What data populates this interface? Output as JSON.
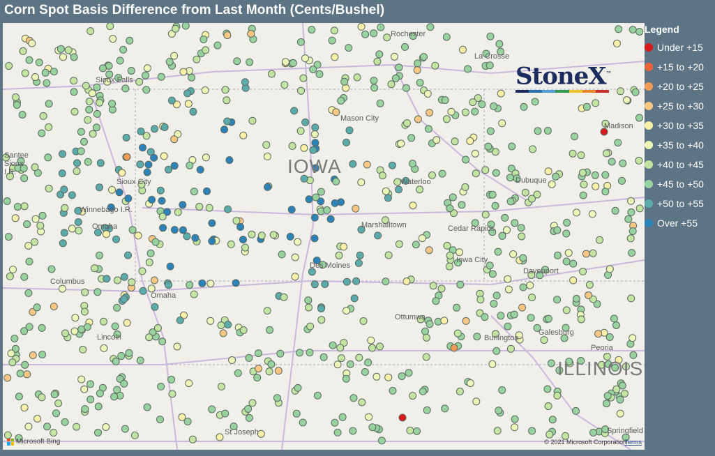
{
  "title": "Corn Spot Basis Difference from Last Month (Cents/Bushel)",
  "legend": {
    "title": "Legend",
    "items": [
      {
        "label": "Under +15",
        "color": "#d7191c"
      },
      {
        "label": "+15 to +20",
        "color": "#e8633a"
      },
      {
        "label": "+20 to +25",
        "color": "#f39a57"
      },
      {
        "label": "+25 to +30",
        "color": "#fbc783"
      },
      {
        "label": "+30 to +35",
        "color": "#fdf1a9"
      },
      {
        "label": "+35 to +40",
        "color": "#eef8b9"
      },
      {
        "label": "+40 to +45",
        "color": "#c4e5a1"
      },
      {
        "label": "+45 to +50",
        "color": "#98d29f"
      },
      {
        "label": "+50 to +55",
        "color": "#5cabab"
      },
      {
        "label": "Over +55",
        "color": "#2b83ba"
      }
    ]
  },
  "logo": {
    "text": "StoneX",
    "tm": "™",
    "bar_colors": [
      "#1d2c5e",
      "#2a6fb0",
      "#4fa0d6",
      "#2e9b50",
      "#f2c230",
      "#e8882e",
      "#c4302b"
    ]
  },
  "map": {
    "state_labels": [
      "IOWA",
      "ILLINOIS"
    ],
    "places": [
      "Rochester",
      "La Crosse",
      "Sioux Falls",
      "Mason City",
      "Madison",
      "Santee Sioux I.R.",
      "Sioux City",
      "Waterloo",
      "Dubuque",
      "Winnebago I.R.",
      "Omaha",
      "Marshalltown",
      "Cedar Rapids",
      "Columbus",
      "Des Moines",
      "Iowa City",
      "Davenport",
      "Ottumwa",
      "Galesburg",
      "Burlington",
      "Peoria",
      "Lincoln",
      "St Joseph",
      "Springfield"
    ],
    "attribution": "© 2021 Microsoft Corporation",
    "terms": "Terms",
    "provider": "Microsoft Bing"
  }
}
